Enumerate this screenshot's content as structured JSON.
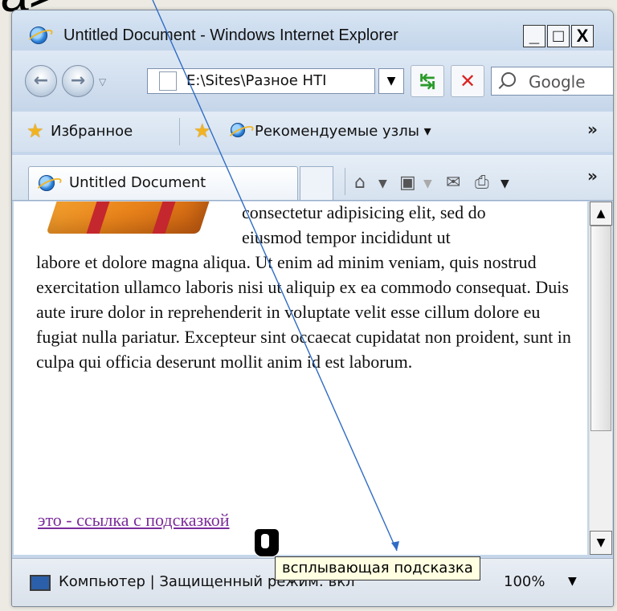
{
  "fragment": "a>",
  "window": {
    "title": "Untitled Document - Windows Internet Explorer",
    "caption_buttons": {
      "minimize": "_",
      "maximize": "□",
      "close": "X"
    }
  },
  "address_bar": {
    "url": "E:\\Sites\\Разное HTI",
    "search_placeholder": "Google"
  },
  "favorites_bar": {
    "favorites_label": "Избранное",
    "suggested_sites_label": "Рекомендуемые узлы ▾",
    "chevron": "»"
  },
  "tabs": {
    "active_tab": "Untitled Document",
    "chevron": "»"
  },
  "content": {
    "paragraph_line1": "consectetur adipisicing elit, sed do",
    "paragraph_line2": "eiusmod tempor incididunt ut",
    "paragraph_rest": "labore et dolore magna aliqua. Ut enim ad minim veniam, quis nostrud exercitation ullamco laboris nisi ut aliquip ex ea commodo consequat. Duis aute irure dolor in reprehenderit in voluptate velit esse cillum dolore eu fugiat nulla pariatur. Excepteur sint occaecat cupidatat non proident, sunt in culpa qui officia deserunt mollit anim id est laborum.",
    "link_text": "это - ссылка с подсказкой"
  },
  "status_bar": {
    "zone_text": "Компьютер | Защищенный режим: вкл",
    "zoom": "100%"
  },
  "tooltip": "всплывающая подсказка",
  "colors": {
    "link_visited": "#7b2c9a",
    "tooltip_bg": "#ffffe1",
    "pointer_line": "#2f6cc4"
  }
}
